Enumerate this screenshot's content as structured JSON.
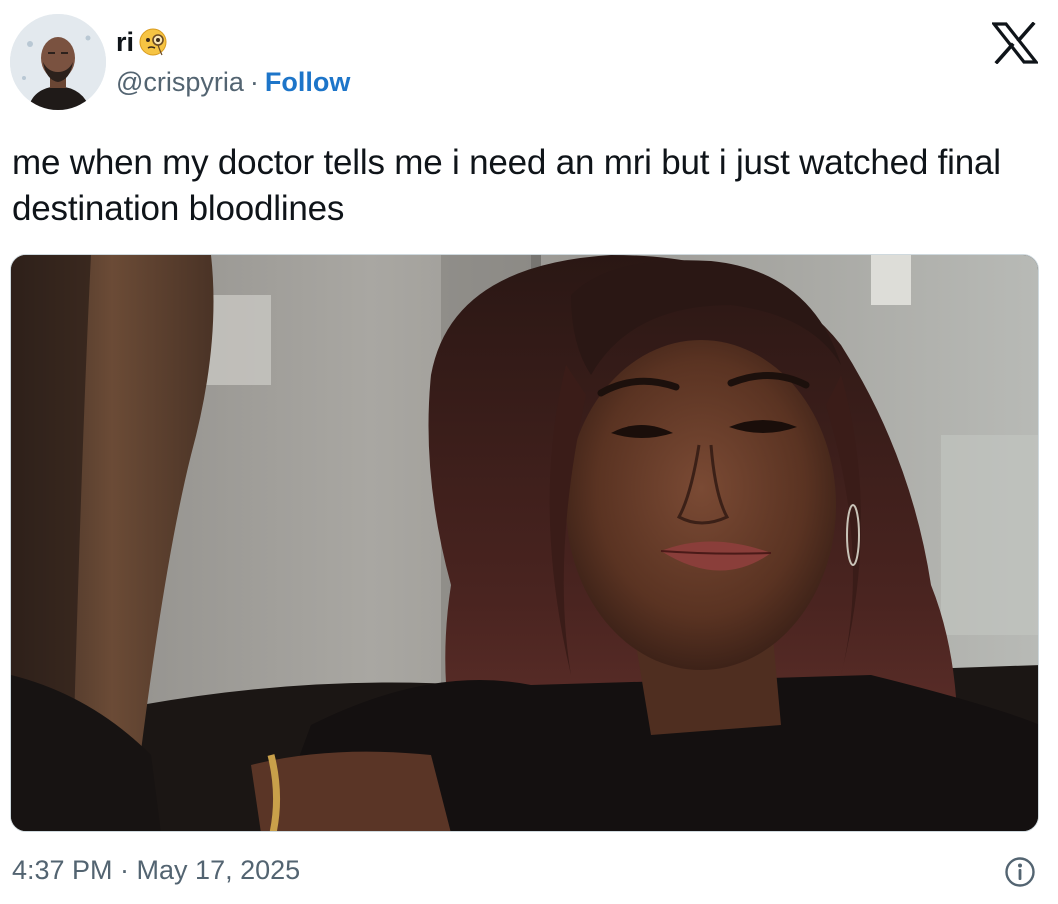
{
  "author": {
    "display_name": "ri",
    "name_emoji": "monocle-face-emoji",
    "handle": "@crispyria",
    "separator": "·",
    "follow_label": "Follow"
  },
  "brand": {
    "logo_icon": "x-logo-icon"
  },
  "tweet": {
    "text": "me when my doctor tells me i need an mri but i just watched final destination bloodlines",
    "media_description_icon": "photo"
  },
  "footer": {
    "timestamp": "4:37 PM · May 17, 2025",
    "info_icon": "info-icon"
  },
  "colors": {
    "text": "#0f1419",
    "secondary": "#536471",
    "link": "#1d75c9",
    "border": "#cfd9de"
  }
}
